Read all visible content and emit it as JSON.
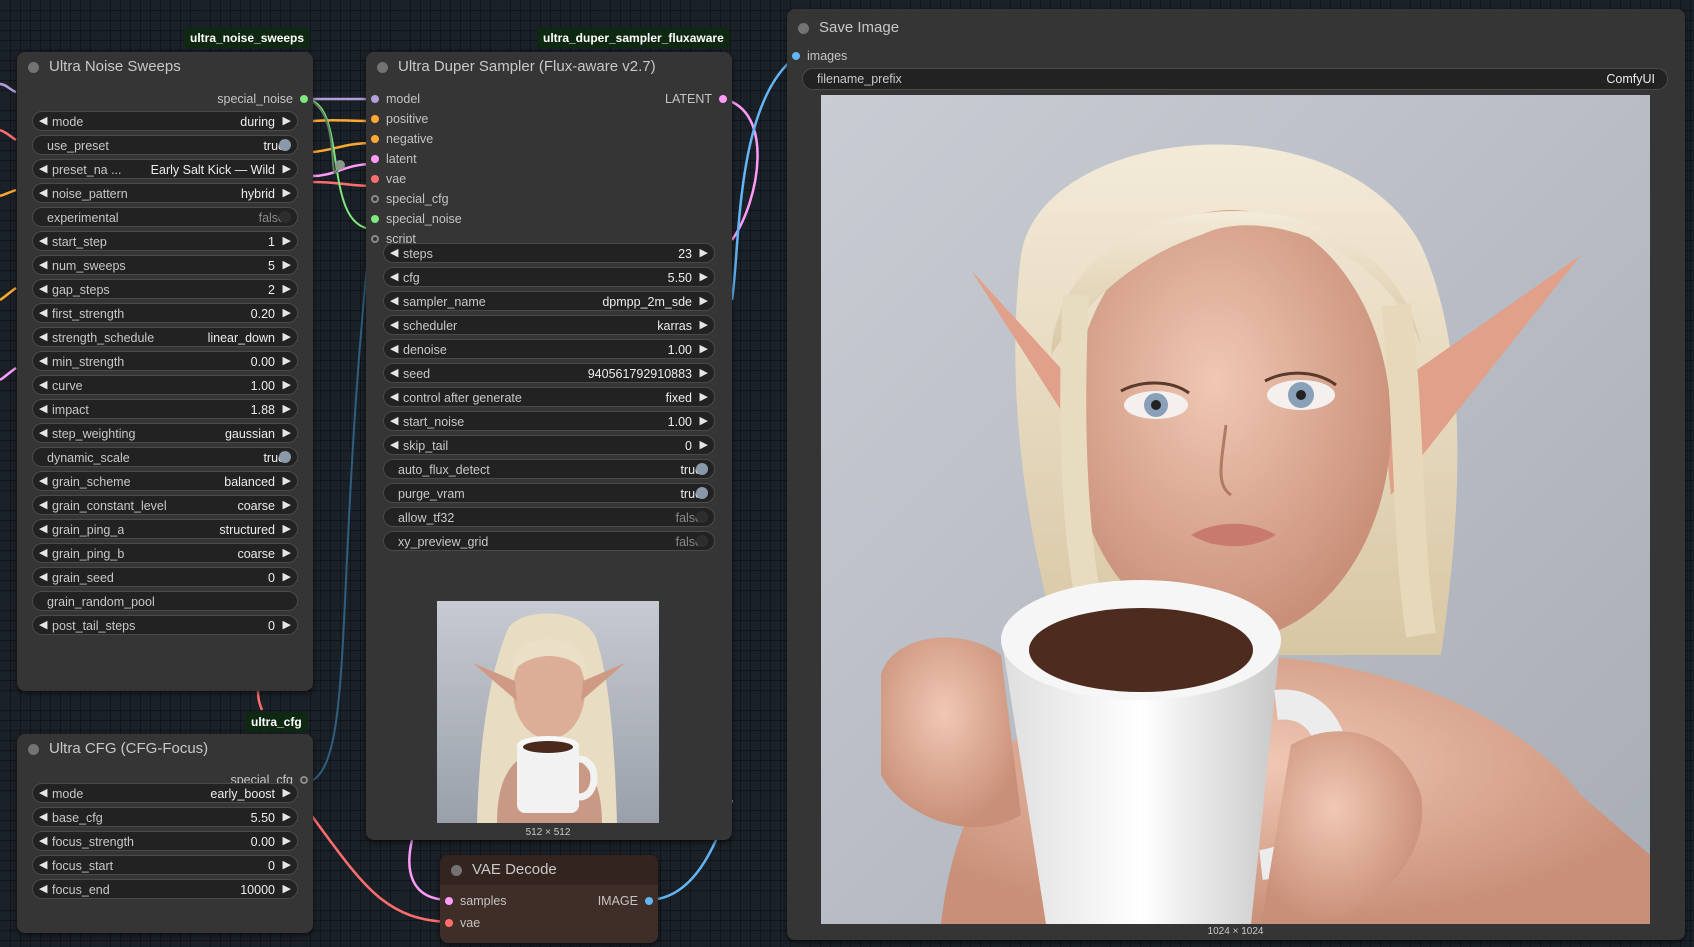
{
  "badges": {
    "sweeps": "ultra_noise_sweeps",
    "sampler": "ultra_duper_sampler_fluxaware",
    "cfg": "ultra_cfg"
  },
  "noise_node": {
    "title": "Ultra Noise Sweeps",
    "output": "special_noise",
    "widgets": [
      {
        "label": "mode",
        "value": "during",
        "kind": "combo"
      },
      {
        "label": "use_preset",
        "value": "true",
        "kind": "toggle",
        "on": true
      },
      {
        "label": "preset_na ...",
        "value": "Early Salt Kick — Wild",
        "kind": "combo"
      },
      {
        "label": "noise_pattern",
        "value": "hybrid",
        "kind": "combo"
      },
      {
        "label": "experimental",
        "value": "false",
        "kind": "toggle",
        "on": false
      },
      {
        "label": "start_step",
        "value": "1",
        "kind": "number"
      },
      {
        "label": "num_sweeps",
        "value": "5",
        "kind": "number"
      },
      {
        "label": "gap_steps",
        "value": "2",
        "kind": "number"
      },
      {
        "label": "first_strength",
        "value": "0.20",
        "kind": "number"
      },
      {
        "label": "strength_schedule",
        "value": "linear_down",
        "kind": "combo"
      },
      {
        "label": "min_strength",
        "value": "0.00",
        "kind": "number"
      },
      {
        "label": "curve",
        "value": "1.00",
        "kind": "number"
      },
      {
        "label": "impact",
        "value": "1.88",
        "kind": "number"
      },
      {
        "label": "step_weighting",
        "value": "gaussian",
        "kind": "combo"
      },
      {
        "label": "dynamic_scale",
        "value": "true",
        "kind": "toggle",
        "on": true
      },
      {
        "label": "grain_scheme",
        "value": "balanced",
        "kind": "combo"
      },
      {
        "label": "grain_constant_level",
        "value": "coarse",
        "kind": "combo"
      },
      {
        "label": "grain_ping_a",
        "value": "structured",
        "kind": "combo"
      },
      {
        "label": "grain_ping_b",
        "value": "coarse",
        "kind": "combo"
      },
      {
        "label": "grain_seed",
        "value": "0",
        "kind": "number"
      },
      {
        "label": "grain_random_pool",
        "value": "",
        "kind": "plain"
      },
      {
        "label": "post_tail_steps",
        "value": "0",
        "kind": "number"
      }
    ]
  },
  "cfg_node": {
    "title": "Ultra CFG (CFG-Focus)",
    "output": "special_cfg",
    "widgets": [
      {
        "label": "mode",
        "value": "early_boost",
        "kind": "combo"
      },
      {
        "label": "base_cfg",
        "value": "5.50",
        "kind": "number"
      },
      {
        "label": "focus_strength",
        "value": "0.00",
        "kind": "number"
      },
      {
        "label": "focus_start",
        "value": "0",
        "kind": "number"
      },
      {
        "label": "focus_end",
        "value": "10000",
        "kind": "number"
      }
    ]
  },
  "sampler_node": {
    "title": "Ultra Duper Sampler (Flux-aware v2.7)",
    "output": "LATENT",
    "inputs": [
      {
        "label": "model",
        "color": "#b39ddb",
        "hollow": false
      },
      {
        "label": "positive",
        "color": "#ffa931",
        "hollow": false
      },
      {
        "label": "negative",
        "color": "#ffa931",
        "hollow": false
      },
      {
        "label": "latent",
        "color": "#ff9cf9",
        "hollow": false
      },
      {
        "label": "vae",
        "color": "#ff6e6e",
        "hollow": false
      },
      {
        "label": "special_cfg",
        "color": "#8a8a8a",
        "hollow": true
      },
      {
        "label": "special_noise",
        "color": "#7ee87e",
        "hollow": false
      },
      {
        "label": "script",
        "color": "#8a8a8a",
        "hollow": true
      }
    ],
    "widgets": [
      {
        "label": "steps",
        "value": "23",
        "kind": "number"
      },
      {
        "label": "cfg",
        "value": "5.50",
        "kind": "number"
      },
      {
        "label": "sampler_name",
        "value": "dpmpp_2m_sde",
        "kind": "combo"
      },
      {
        "label": "scheduler",
        "value": "karras",
        "kind": "combo"
      },
      {
        "label": "denoise",
        "value": "1.00",
        "kind": "number"
      },
      {
        "label": "seed",
        "value": "940561792910883",
        "kind": "number"
      },
      {
        "label": "control after generate",
        "value": "fixed",
        "kind": "combo"
      },
      {
        "label": "start_noise",
        "value": "1.00",
        "kind": "number"
      },
      {
        "label": "skip_tail",
        "value": "0",
        "kind": "number"
      },
      {
        "label": "auto_flux_detect",
        "value": "true",
        "kind": "toggle",
        "on": true
      },
      {
        "label": "purge_vram",
        "value": "true",
        "kind": "toggle",
        "on": true
      },
      {
        "label": "allow_tf32",
        "value": "false",
        "kind": "toggle",
        "on": false
      },
      {
        "label": "xy_preview_grid",
        "value": "false",
        "kind": "toggle",
        "on": false
      }
    ],
    "preview_caption": "512 × 512"
  },
  "vae_node": {
    "title": "VAE Decode",
    "inputs": [
      {
        "label": "samples",
        "color": "#ff9cf9"
      },
      {
        "label": "vae",
        "color": "#ff6e6e"
      }
    ],
    "output": "IMAGE"
  },
  "save_node": {
    "title": "Save Image",
    "input": "images",
    "widget": {
      "label": "filename_prefix",
      "value": "ComfyUI"
    },
    "image_caption": "1024 × 1024"
  },
  "colors": {
    "latent_link": "#ff9cf9",
    "image_link": "#64b5f6",
    "vae_link": "#ff6e6e",
    "conditioning_link": "#ffa931",
    "model_link": "#b39ddb",
    "noise_link": "#7ee87e"
  }
}
